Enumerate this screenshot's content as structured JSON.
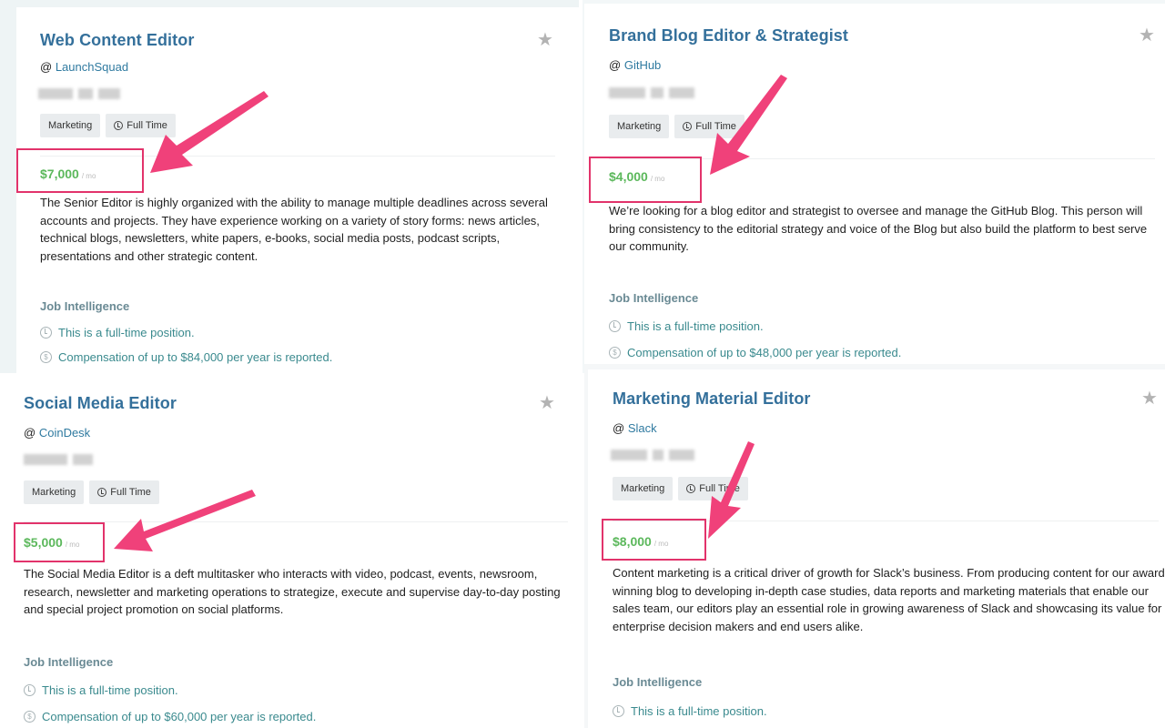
{
  "jobs": [
    {
      "title": "Web Content Editor",
      "at": "@",
      "company": "LaunchSquad",
      "tags": [
        "Marketing",
        "Full Time"
      ],
      "salary": "$7,000",
      "salary_period": "/ mo",
      "description": "The Senior Editor is highly organized with the ability to manage multiple deadlines across several accounts and projects. They have experience working on a variety of story forms: news articles, technical blogs, newsletters, white papers, e-books, social media posts, podcast scripts, presentations and other strategic content.",
      "intel_title": "Job Intelligence",
      "intel": [
        "This is a full-time position.",
        "Compensation of up to $84,000 per year is reported."
      ]
    },
    {
      "title": "Brand Blog Editor & Strategist",
      "at": "@",
      "company": "GitHub",
      "tags": [
        "Marketing",
        "Full Time"
      ],
      "salary": "$4,000",
      "salary_period": "/ mo",
      "description": "We’re looking for a blog editor and strategist to oversee and manage the GitHub Blog. This person will bring consistency to the editorial strategy and voice of the Blog but also build the platform to best serve our community.",
      "intel_title": "Job Intelligence",
      "intel": [
        "This is a full-time position.",
        "Compensation of up to $48,000 per year is reported."
      ]
    },
    {
      "title": "Social Media Editor",
      "at": "@",
      "company": "CoinDesk",
      "tags": [
        "Marketing",
        "Full Time"
      ],
      "salary": "$5,000",
      "salary_period": "/ mo",
      "description": "The Social Media Editor is a deft multitasker who interacts with video, podcast, events, newsroom, research, newsletter and marketing operations to strategize, execute and supervise day-to-day posting and special project promotion on social platforms.",
      "intel_title": "Job Intelligence",
      "intel": [
        "This is a full-time position.",
        "Compensation of up to $60,000 per year is reported."
      ]
    },
    {
      "title": "Marketing Material Editor",
      "at": "@",
      "company": "Slack",
      "tags": [
        "Marketing",
        "Full Time"
      ],
      "salary": "$8,000",
      "salary_period": "/ mo",
      "description": "Content marketing is a critical driver of growth for Slack’s business. From producing content for our award-winning blog to developing in-depth case studies, data reports and marketing materials that enable our sales team, our editors play an essential role in growing awareness of Slack and showcasing its value for enterprise decision makers and end users alike.",
      "intel_title": "Job Intelligence",
      "intel": [
        "This is a full-time position."
      ]
    }
  ],
  "icons": {
    "star": "★",
    "dollar": "$"
  },
  "colors": {
    "title": "#34709b",
    "salary": "#5cb85c",
    "highlight": "#e2336b",
    "company_link": "#2f7aa0",
    "intel_text": "#3a8a8e"
  }
}
